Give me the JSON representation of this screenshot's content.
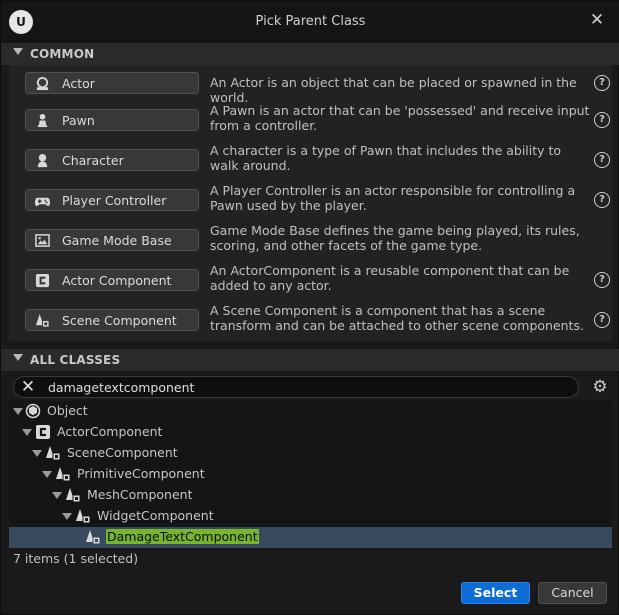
{
  "window": {
    "title": "Pick Parent Class",
    "logo_text": "U"
  },
  "common": {
    "header": "COMMON",
    "items": [
      {
        "label": "Actor",
        "icon": "actor-icon",
        "description": "An Actor is an object that can be placed or spawned in the world.",
        "help": "?"
      },
      {
        "label": "Pawn",
        "icon": "pawn-icon",
        "description": "A Pawn is an actor that can be 'possessed' and receive input from a controller.",
        "help": "?"
      },
      {
        "label": "Character",
        "icon": "character-icon",
        "description": "A character is a type of Pawn that includes the ability to walk around.",
        "help": "?"
      },
      {
        "label": "Player Controller",
        "icon": "gamepad-icon",
        "description": "A Player Controller is an actor responsible for controlling a Pawn used by the player.",
        "help": "?"
      },
      {
        "label": "Game Mode Base",
        "icon": "game-mode-icon",
        "description": "Game Mode Base defines the game being played, its rules, scoring, and other facets of the game type.",
        "help": ""
      },
      {
        "label": "Actor Component",
        "icon": "actor-component-icon",
        "description": "An ActorComponent is a reusable component that can be added to any actor.",
        "help": "?"
      },
      {
        "label": "Scene Component",
        "icon": "scene-component-icon",
        "description": "A Scene Component is a component that has a scene transform and can be attached to other scene components.",
        "help": "?"
      }
    ]
  },
  "all_classes": {
    "header": "ALL CLASSES",
    "search_value": "damagetextcomponent",
    "clear_glyph": "✕",
    "settings_glyph": "⚙",
    "tree": [
      {
        "label": "Object",
        "icon": "object-icon",
        "expanded": true,
        "selected": false
      },
      {
        "label": "ActorComponent",
        "icon": "actor-component-icon",
        "expanded": true,
        "selected": false
      },
      {
        "label": "SceneComponent",
        "icon": "scene-component-icon",
        "expanded": true,
        "selected": false
      },
      {
        "label": "PrimitiveComponent",
        "icon": "scene-component-icon",
        "expanded": true,
        "selected": false
      },
      {
        "label": "MeshComponent",
        "icon": "scene-component-icon",
        "expanded": true,
        "selected": false
      },
      {
        "label": "WidgetComponent",
        "icon": "scene-component-icon",
        "expanded": true,
        "selected": false
      },
      {
        "label": "DamageTextComponent",
        "icon": "scene-component-icon",
        "expanded": false,
        "selected": true
      }
    ],
    "status": "7 items (1 selected)"
  },
  "footer": {
    "select_label": "Select",
    "cancel_label": "Cancel"
  },
  "colors": {
    "accent": "#0e6cd6",
    "highlight": "#77b52b",
    "selection": "#3a4a5e"
  }
}
